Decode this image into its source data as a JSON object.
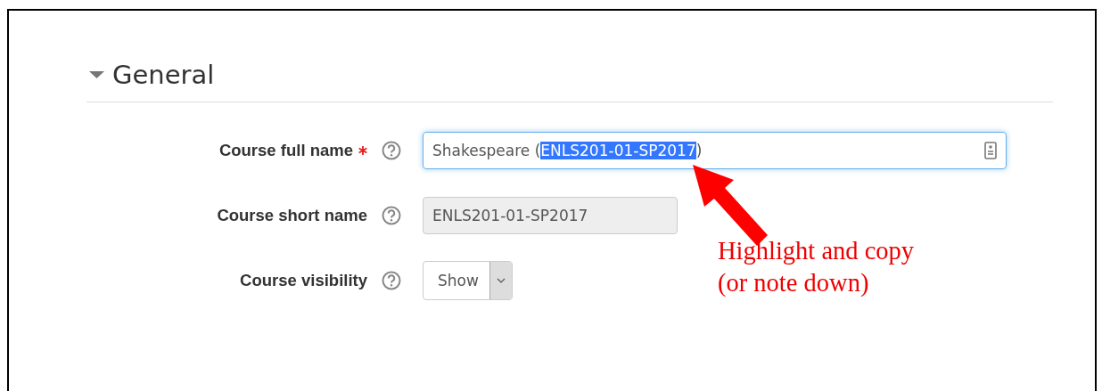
{
  "section": {
    "title": "General",
    "expanded": true
  },
  "fields": [
    {
      "kind": "text",
      "label": "Course full name",
      "required": true,
      "disabled": false,
      "focused": true,
      "parts": [
        {
          "text": "Shakespeare (",
          "selected": false
        },
        {
          "text": "ENLS201-01-SP2017",
          "selected": true
        },
        {
          "text": ")",
          "selected": false
        }
      ]
    },
    {
      "kind": "text",
      "label": "Course short name",
      "required": false,
      "disabled": true,
      "focused": false,
      "parts": [
        {
          "text": "ENLS201-01-SP2017",
          "selected": false
        }
      ]
    },
    {
      "kind": "select",
      "label": "Course visibility",
      "value": "Show"
    }
  ],
  "annotation": {
    "lines": [
      "Highlight and copy",
      "(or note down)"
    ]
  }
}
